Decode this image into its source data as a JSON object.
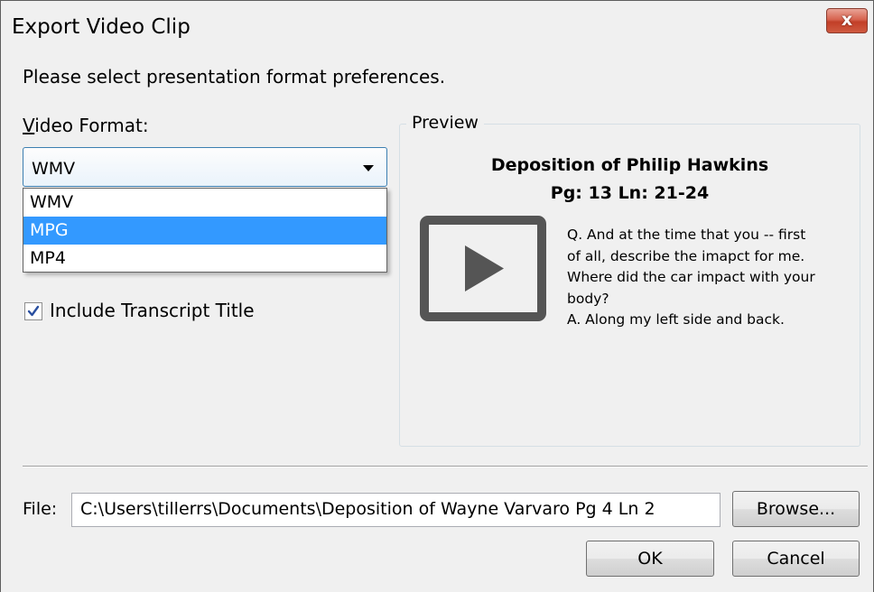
{
  "window": {
    "title": "Export Video Clip",
    "close_label": "x"
  },
  "instruction": "Please select presentation format preferences.",
  "video_format": {
    "label_accel": "V",
    "label_rest": "ideo Format:",
    "selected": "WMV",
    "options": [
      "WMV",
      "MPG",
      "MP4"
    ],
    "highlighted": "MPG"
  },
  "include_title": {
    "label": "Include Transcript Title",
    "checked": true
  },
  "preview": {
    "legend": "Preview",
    "title_line1": "Deposition of Philip Hawkins",
    "title_line2": "Pg: 13 Ln: 21-24",
    "text_lines": [
      "Q.  And at the time that you -- first",
      "of all, describe the imapct for me.",
      "Where did the car impact with your",
      "body?",
      "A.  Along my left side and back."
    ]
  },
  "file": {
    "label": "File:",
    "path": "C:\\Users\\tillerrs\\Documents\\Deposition of Wayne Varvaro Pg 4 Ln 2"
  },
  "buttons": {
    "browse": "Browse...",
    "ok": "OK",
    "cancel": "Cancel"
  },
  "colors": {
    "selection": "#3399ff",
    "close": "#c94a33",
    "play_icon": "#555555"
  }
}
